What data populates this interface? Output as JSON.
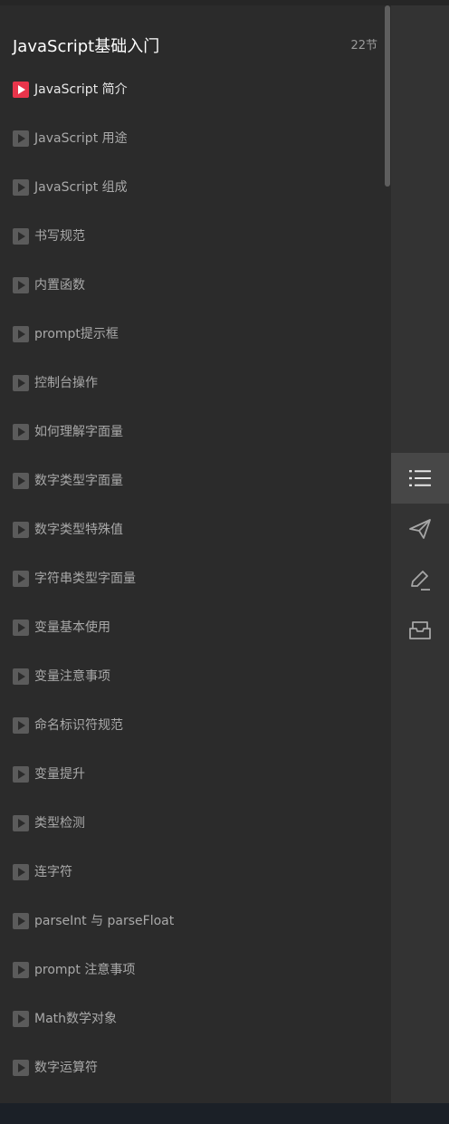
{
  "course": {
    "title": "JavaScript基础入门",
    "lesson_count": "22节"
  },
  "lessons": [
    {
      "label": "JavaScript 简介",
      "active": true
    },
    {
      "label": "JavaScript 用途",
      "active": false
    },
    {
      "label": "JavaScript 组成",
      "active": false
    },
    {
      "label": "书写规范",
      "active": false
    },
    {
      "label": "内置函数",
      "active": false
    },
    {
      "label": "prompt提示框",
      "active": false
    },
    {
      "label": "控制台操作",
      "active": false
    },
    {
      "label": "如何理解字面量",
      "active": false
    },
    {
      "label": "数字类型字面量",
      "active": false
    },
    {
      "label": "数字类型特殊值",
      "active": false
    },
    {
      "label": "字符串类型字面量",
      "active": false
    },
    {
      "label": "变量基本使用",
      "active": false
    },
    {
      "label": "变量注意事项",
      "active": false
    },
    {
      "label": "命名标识符规范",
      "active": false
    },
    {
      "label": "变量提升",
      "active": false
    },
    {
      "label": "类型检测",
      "active": false
    },
    {
      "label": "连字符",
      "active": false
    },
    {
      "label": "parseInt 与 parseFloat",
      "active": false
    },
    {
      "label": "prompt 注意事项",
      "active": false
    },
    {
      "label": "Math数学对象",
      "active": false
    },
    {
      "label": "数字运算符",
      "active": false
    }
  ],
  "rail": {
    "items": [
      {
        "icon": "list-icon",
        "active": true
      },
      {
        "icon": "send-icon",
        "active": false
      },
      {
        "icon": "edit-icon",
        "active": false
      },
      {
        "icon": "inbox-icon",
        "active": false
      }
    ]
  },
  "colors": {
    "panel_bg": "#2b2b2b",
    "rail_bg": "#333333",
    "active_play": "#e8354b",
    "inactive_play": "#5b5b5b"
  }
}
